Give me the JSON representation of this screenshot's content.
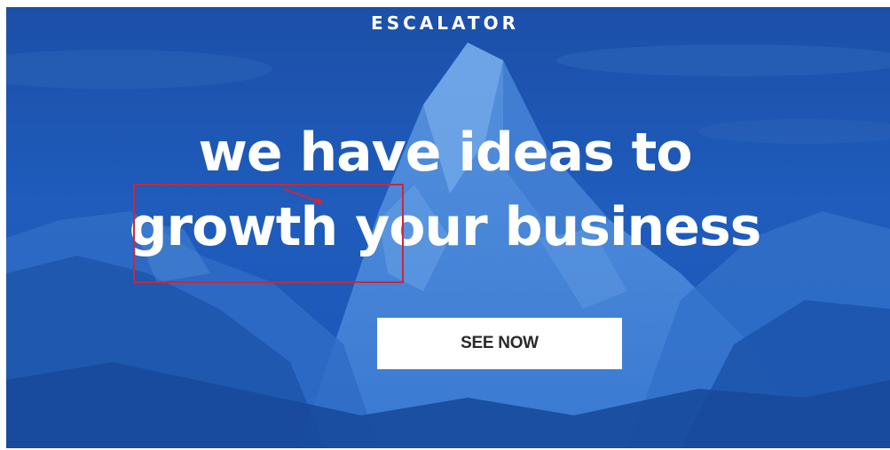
{
  "brand": {
    "name": "ESCALATOR"
  },
  "hero": {
    "headline_line1": "we have ideas to",
    "headline_line2": "growth your business",
    "cta_label": "SEE NOW"
  },
  "colors": {
    "overlay_blue": "#1f5fbf",
    "annotation_red": "#c8283c",
    "button_bg": "#ffffff",
    "button_text": "#2a2a2a"
  }
}
